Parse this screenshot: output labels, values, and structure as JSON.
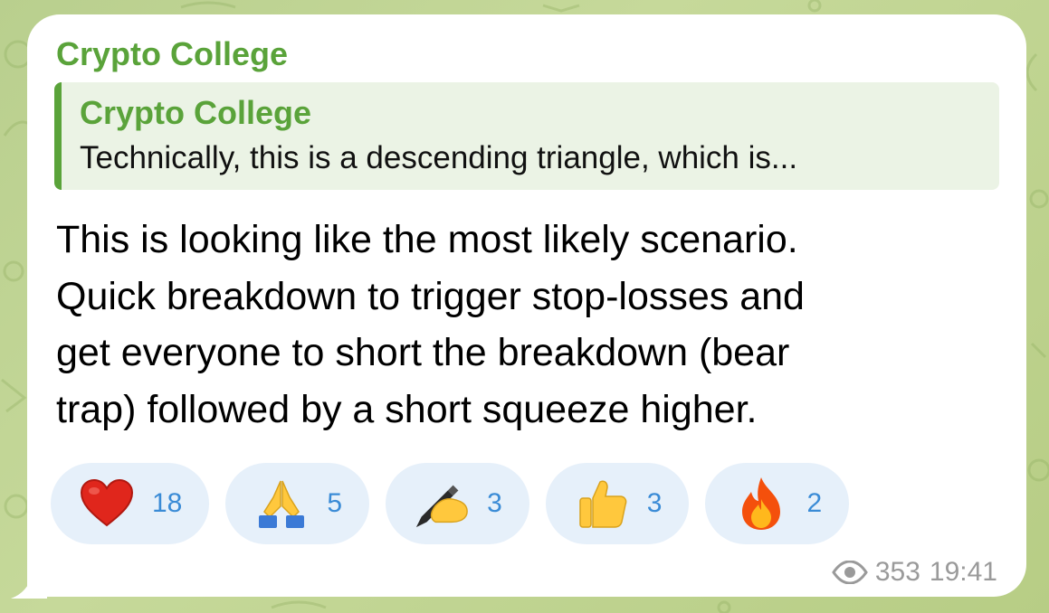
{
  "message": {
    "sender": "Crypto College",
    "reply": {
      "name": "Crypto College",
      "text": "Technically, this is a descending triangle, which is..."
    },
    "text_lines": [
      "This is looking like the most likely scenario.",
      "Quick breakdown to trigger stop-losses and",
      "get everyone to short the breakdown (bear",
      "trap) followed by a short squeeze higher."
    ],
    "reactions": [
      {
        "emoji": "red-heart-icon",
        "count": "18"
      },
      {
        "emoji": "folded-hands-icon",
        "count": "5"
      },
      {
        "emoji": "writing-hand-icon",
        "count": "3"
      },
      {
        "emoji": "thumbs-up-icon",
        "count": "3"
      },
      {
        "emoji": "fire-icon",
        "count": "2"
      }
    ],
    "views": "353",
    "time": "19:41"
  },
  "colors": {
    "accent_green": "#5aa33a",
    "reply_background": "#ebf3e5",
    "reaction_background": "#e6f0fa",
    "reaction_count": "#3a8bd6",
    "meta_text": "#9a9a9a",
    "wallpaper": "#b9cf8e"
  }
}
